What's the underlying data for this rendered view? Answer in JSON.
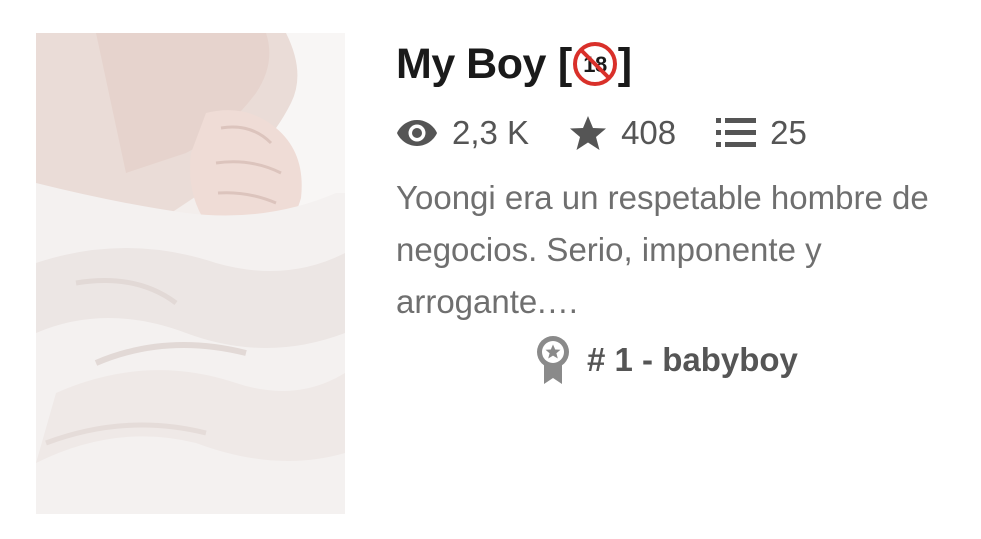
{
  "story": {
    "title": "My Boy",
    "title_open_bracket": "[",
    "title_close_bracket": "]",
    "rating_badge_text": "18",
    "cover_alt": "Story cover image",
    "stats": {
      "reads": "2,3 K",
      "votes": "408",
      "parts": "25"
    },
    "description": "Yoongi era un respetable hombre de negocios. Serio, imponente y arrogante.…",
    "ranking": "# 1 - babyboy"
  },
  "icons": {
    "reads": "eye-icon",
    "votes": "star-icon",
    "parts": "list-icon",
    "ranking": "award-ribbon-icon",
    "rating": "no-under-18-icon"
  },
  "colors": {
    "title": "#1a1a1a",
    "stats": "#555555",
    "description": "#6f6f6f",
    "badge_red": "#d9302a"
  }
}
